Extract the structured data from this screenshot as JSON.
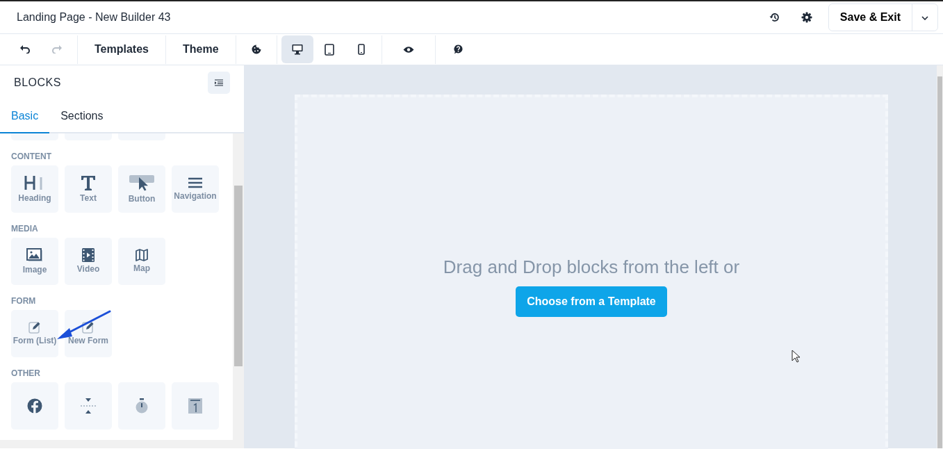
{
  "window": {
    "title": "Landing Page - New Builder 43"
  },
  "header_actions": {
    "save_button": "Save & Exit"
  },
  "toolbar": {
    "text_buttons": [
      "Templates",
      "Theme"
    ],
    "devices": [
      {
        "kind": "desktop",
        "selected": true
      },
      {
        "kind": "tablet",
        "selected": false
      },
      {
        "kind": "mobile",
        "selected": false
      }
    ]
  },
  "sidebar": {
    "title": "BLOCKS",
    "tabs": [
      {
        "label": "Basic",
        "selected": true
      },
      {
        "label": "Sections",
        "selected": false
      }
    ],
    "categories": [
      {
        "title": "CONTENT",
        "blocks": [
          {
            "kind": "heading",
            "label": "Heading"
          },
          {
            "kind": "text",
            "label": "Text"
          },
          {
            "kind": "button",
            "label": "Button"
          },
          {
            "kind": "navigation",
            "label": "Navigation"
          }
        ]
      },
      {
        "title": "MEDIA",
        "blocks": [
          {
            "kind": "image",
            "label": "Image"
          },
          {
            "kind": "video",
            "label": "Video"
          },
          {
            "kind": "map",
            "label": "Map"
          }
        ]
      },
      {
        "title": "FORM",
        "blocks": [
          {
            "kind": "form",
            "label": "Form (List)"
          },
          {
            "kind": "form",
            "label": "New Form"
          }
        ]
      },
      {
        "title": "OTHER",
        "blocks": [
          {
            "kind": "social"
          },
          {
            "kind": "divider"
          },
          {
            "kind": "timer"
          },
          {
            "kind": "counter"
          }
        ]
      }
    ]
  },
  "canvas": {
    "message": "Drag and Drop blocks from the left or",
    "template_button": "Choose from a Template"
  }
}
